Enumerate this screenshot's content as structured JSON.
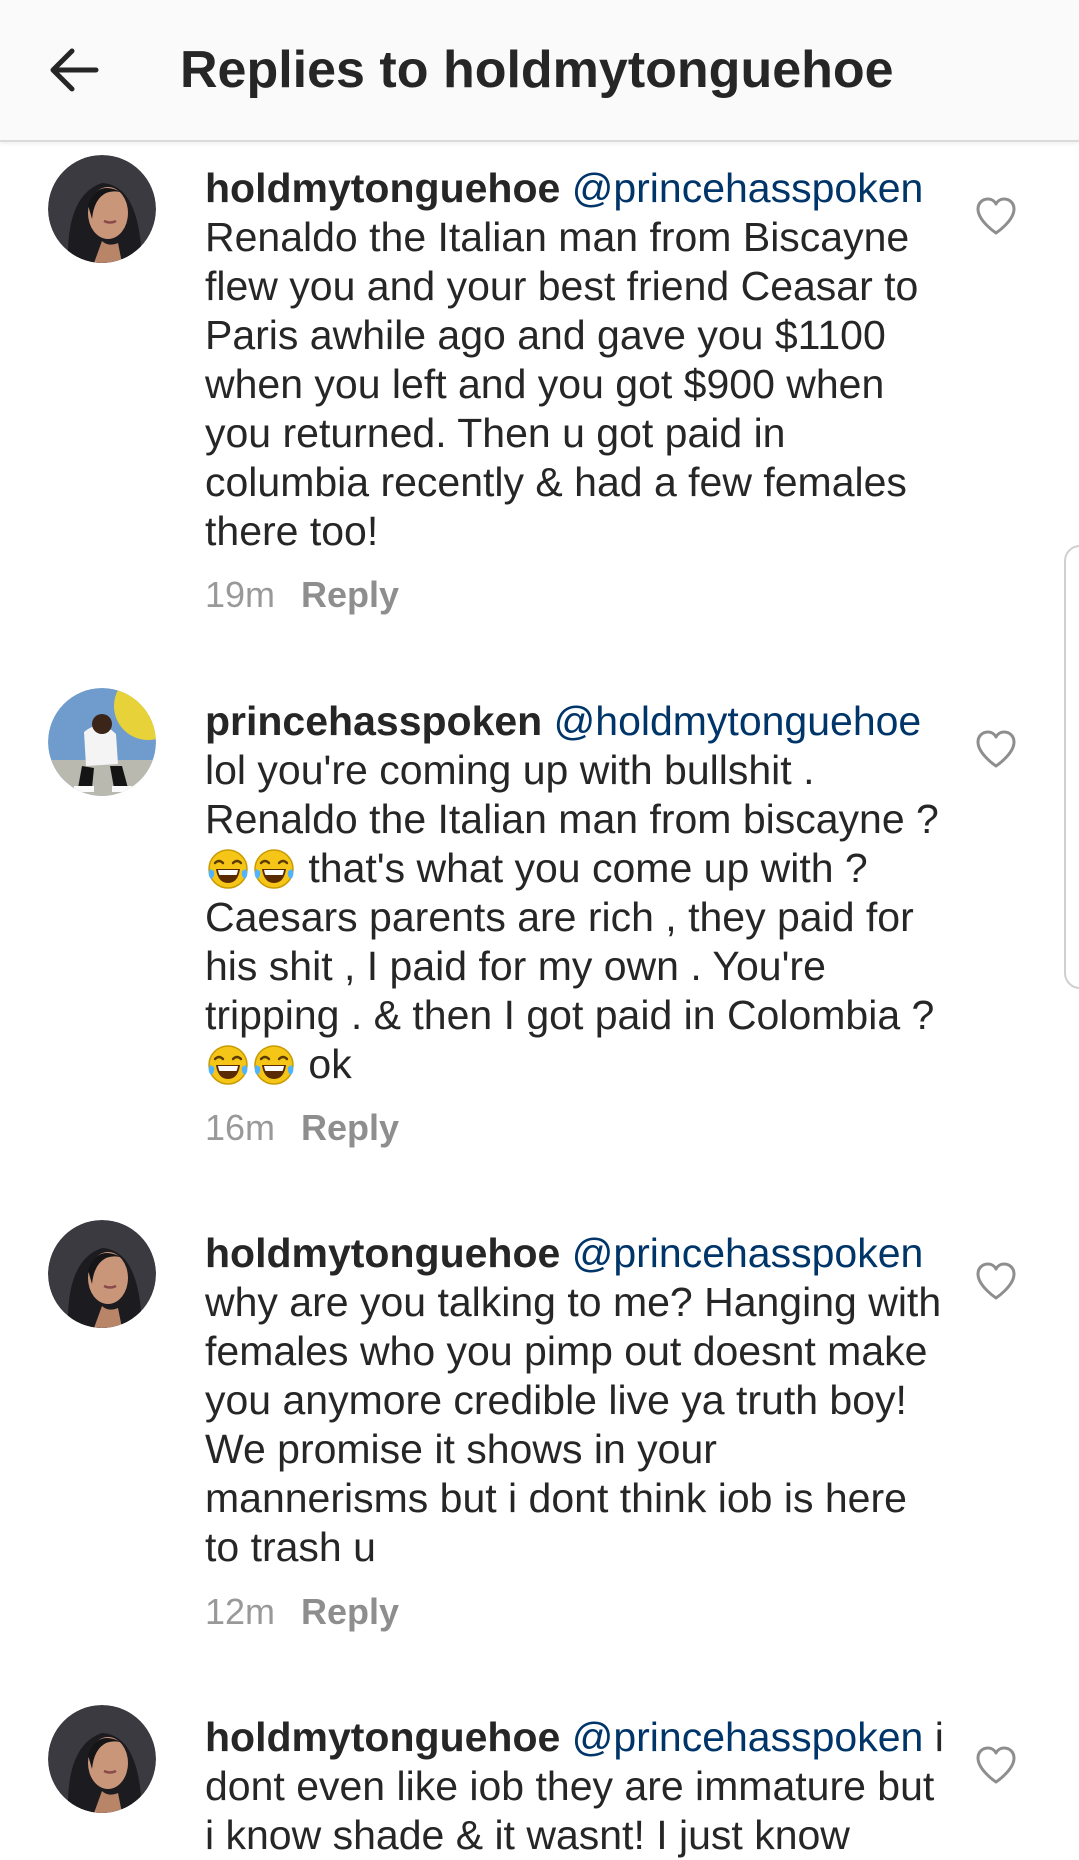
{
  "header": {
    "title": "Replies to holdmytonguehoe"
  },
  "comments": [
    {
      "username": "holdmytonguehoe",
      "mention": "@princehasspoken",
      "segments": [
        {
          "type": "text",
          "text": "Renaldo the Italian man from Biscayne flew you and your best friend Ceasar to Paris awhile ago and gave you $1100 when you left and you got $900 when you returned. Then u got paid in columbia recently & had a few females there too!"
        }
      ],
      "time": "19m",
      "reply_label": "Reply"
    },
    {
      "username": "princehasspoken",
      "mention": "@holdmytonguehoe",
      "segments": [
        {
          "type": "text",
          "text": "lol you're coming up with bullshit . Renaldo the Italian man from biscayne ? "
        },
        {
          "type": "emoji",
          "name": "face-with-tears-of-joy-emoji"
        },
        {
          "type": "emoji",
          "name": "face-with-tears-of-joy-emoji"
        },
        {
          "type": "text",
          "text": " that's what you come up with ? Caesars parents are rich , they paid for his shit , I paid for my own . You're tripping . & then I got paid in Colombia ? "
        },
        {
          "type": "emoji",
          "name": "face-with-tears-of-joy-emoji"
        },
        {
          "type": "emoji",
          "name": "face-with-tears-of-joy-emoji"
        },
        {
          "type": "text",
          "text": " ok"
        }
      ],
      "time": "16m",
      "reply_label": "Reply"
    },
    {
      "username": "holdmytonguehoe",
      "mention": "@princehasspoken",
      "segments": [
        {
          "type": "text",
          "text": "why are you talking to me? Hanging with females who you pimp out doesnt make you anymore credible live ya truth boy! We promise it shows in your mannerisms but i dont think iob is here to trash u"
        }
      ],
      "time": "12m",
      "reply_label": "Reply"
    },
    {
      "username": "holdmytonguehoe",
      "mention": "@princehasspoken",
      "segments": [
        {
          "type": "text",
          "text": "i dont even like iob they are immature but i know shade & it wasnt! I just know"
        }
      ],
      "time": "",
      "reply_label": ""
    }
  ],
  "icons": {
    "back": "arrow-left-icon",
    "like": "heart-outline-icon",
    "emoji": "face-with-tears-of-joy-emoji"
  },
  "colors": {
    "text": "#262626",
    "mention": "#003569",
    "meta": "#999999",
    "header_bg": "#fafafa",
    "heart_stroke": "#8e8e8e"
  }
}
